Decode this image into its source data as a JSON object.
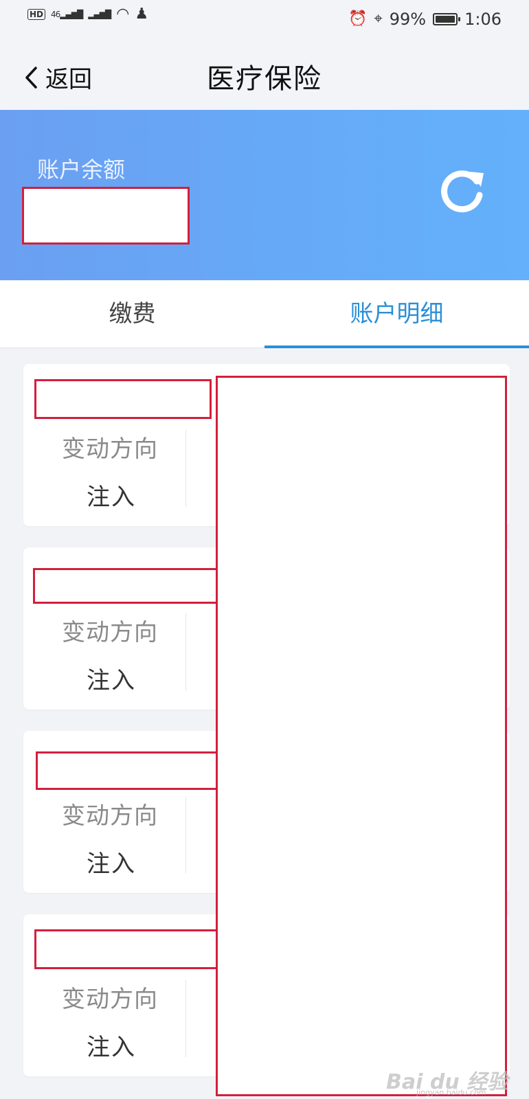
{
  "status_bar": {
    "left_tags": [
      "HD",
      "46"
    ],
    "battery_percent": "99%",
    "battery_level": 0.99,
    "time": "1:06",
    "icons": [
      "hd-icon",
      "signal-icon",
      "wifi-icon",
      "qq-icon",
      "alarm-icon",
      "location-icon",
      "battery-icon"
    ]
  },
  "nav": {
    "back_label": "返回",
    "title": "医疗保险"
  },
  "banner": {
    "balance_label": "账户余额",
    "balance_value": "",
    "refresh_icon": "refresh-icon",
    "gradient": [
      "#6b9ff1",
      "#64b0fb"
    ]
  },
  "tabs": [
    {
      "label": "缴费",
      "active": false
    },
    {
      "label": "账户明细",
      "active": true
    }
  ],
  "accent_color": "#2b8fd6",
  "redaction_color": "#d21f3c",
  "records": [
    {
      "field_label": "变动方向",
      "field_value": "注入"
    },
    {
      "field_label": "变动方向",
      "field_value": "注入"
    },
    {
      "field_label": "变动方向",
      "field_value": "注入"
    },
    {
      "field_label": "变动方向",
      "field_value": "注入"
    }
  ],
  "watermark": {
    "text": "Bai du 经验",
    "sub": "jingyan.baidu.com"
  }
}
